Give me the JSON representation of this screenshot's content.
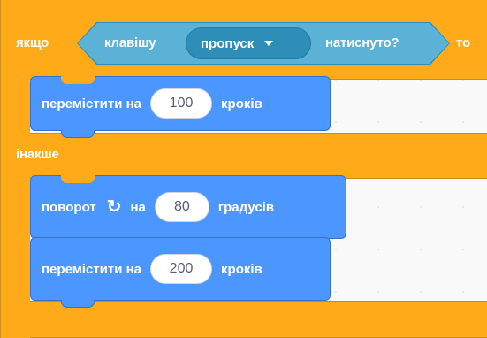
{
  "if_block": {
    "if_label": "якщо",
    "then_label": "то",
    "else_label": "інакше",
    "color": "#ffab19"
  },
  "condition": {
    "prefix": "клавішу",
    "key_value": "пропуск",
    "suffix": "натиснуто?",
    "color": "#5cb1d6"
  },
  "blocks": [
    {
      "text_before": "перемістити на",
      "value": "100",
      "text_after": "кроків"
    },
    {
      "text_before": "поворот",
      "icon": "rotate-clockwise-icon",
      "text_mid": "на",
      "value": "80",
      "text_after": "градусів"
    },
    {
      "text_before": "перемістити на",
      "value": "200",
      "text_after": "кроків"
    }
  ],
  "motion_color": "#4c97ff"
}
